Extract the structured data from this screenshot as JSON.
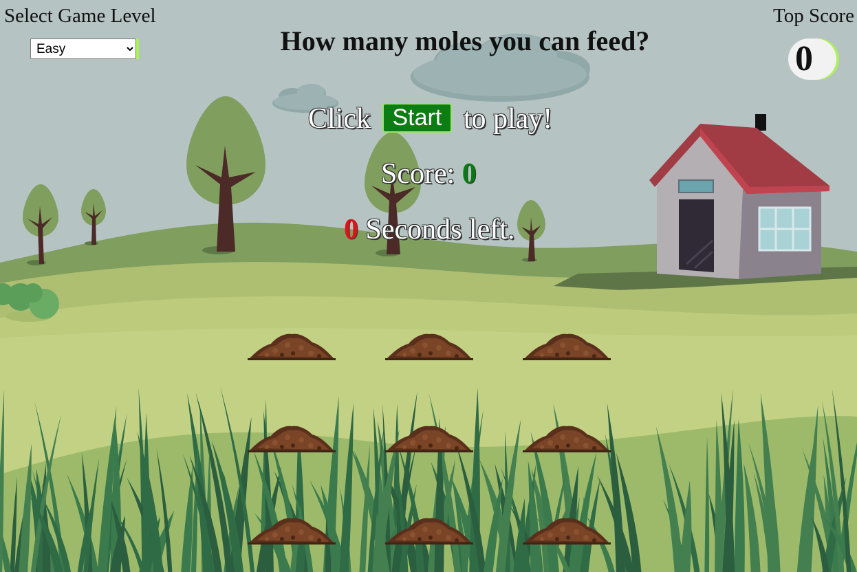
{
  "level": {
    "title": "Select Game Level",
    "selected": "Easy",
    "options": [
      "Easy"
    ]
  },
  "top_score": {
    "label": "Top Score",
    "value": "0"
  },
  "headline": "How many moles you can feed?",
  "prompt": {
    "before": "Click",
    "button": "Start",
    "after": "to play!"
  },
  "score": {
    "label": "Score:",
    "value": "0"
  },
  "timer": {
    "value": "0",
    "label": "Seconds left."
  },
  "holes": [
    {
      "row": 1,
      "col": 1
    },
    {
      "row": 1,
      "col": 2
    },
    {
      "row": 1,
      "col": 3
    },
    {
      "row": 2,
      "col": 1
    },
    {
      "row": 2,
      "col": 2
    },
    {
      "row": 2,
      "col": 3
    },
    {
      "row": 3,
      "col": 1
    },
    {
      "row": 3,
      "col": 2
    },
    {
      "row": 3,
      "col": 3
    }
  ],
  "colors": {
    "sky": "#b6c3c3",
    "start_button": "#0b7d12",
    "score_value": "#0a7a12",
    "timer_value": "#e0121a",
    "accent": "#aef05a"
  }
}
